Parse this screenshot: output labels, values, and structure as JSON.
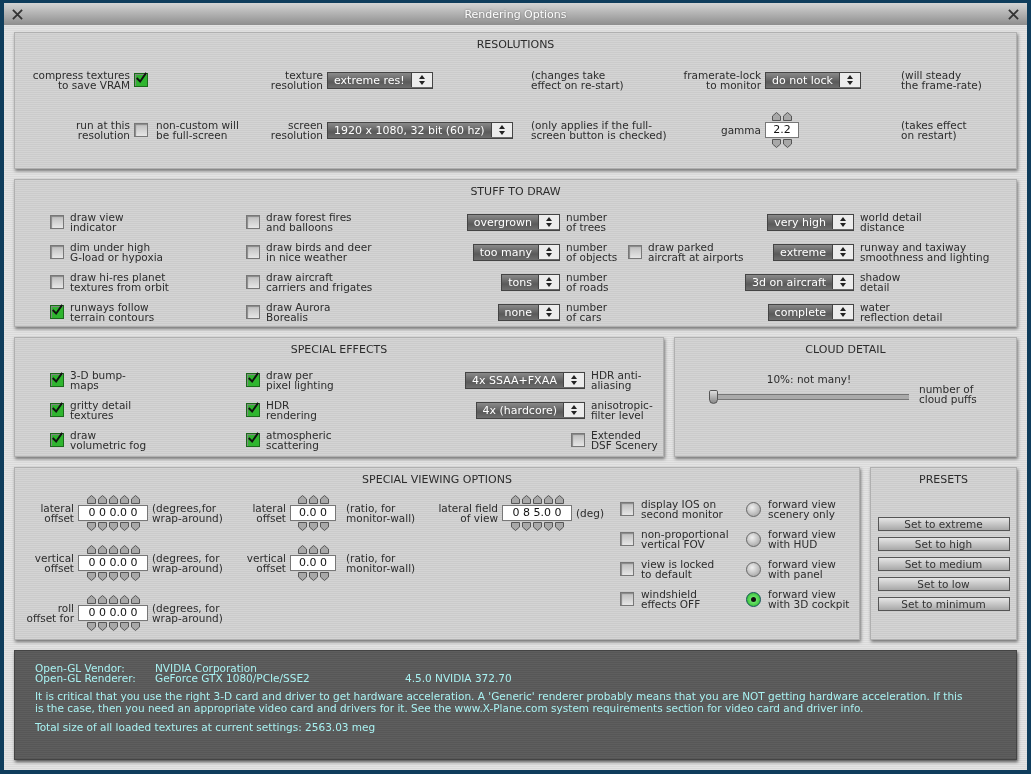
{
  "window": {
    "title": "Rendering Options"
  },
  "resolutions": {
    "title": "RESOLUTIONS",
    "rows": [
      [
        {
          "kind": "checkbox",
          "label": "compress textures\nto save VRAM",
          "checked": true
        },
        {
          "kind": "dropdown",
          "label": "texture\nresolution",
          "value": "extreme res!",
          "note": "(changes take\neffect on re-start)"
        },
        {
          "kind": "dropdown",
          "label": "framerate-lock\nto monitor",
          "value": "do not lock",
          "note": "(will steady\nthe frame-rate)"
        }
      ],
      [
        {
          "kind": "checkbox",
          "label": "run at this\nresolution",
          "note": "non-custom will\nbe full-screen",
          "checked": false
        },
        {
          "kind": "dropdown",
          "label": "screen\nresolution",
          "value": "1920 x 1080, 32 bit (60 hz)",
          "note": "(only applies if the full-\nscreen button is checked)"
        },
        {
          "kind": "spinner",
          "label": "gamma",
          "value": "2.2",
          "note": "(takes effect\non restart)"
        }
      ]
    ]
  },
  "stuff_to_draw": {
    "title": "STUFF TO DRAW",
    "rows": [
      [
        {
          "kind": "checkbox",
          "note": "draw view\nindicator",
          "checked": false
        },
        {
          "kind": "checkbox",
          "note": "draw forest fires\nand balloons",
          "checked": false
        },
        {
          "kind": "dropdown",
          "value": "overgrown",
          "note": "number\nof trees"
        },
        {
          "kind": "dropdown",
          "value": "very high",
          "note": "world detail\ndistance"
        }
      ],
      [
        {
          "kind": "checkbox",
          "note": "dim under high\nG-load or hypoxia",
          "checked": false
        },
        {
          "kind": "checkbox",
          "note": "draw birds and deer\nin nice weather",
          "checked": false
        },
        {
          "kind": "dropdown",
          "value": "too many",
          "note": "number\nof objects"
        },
        {
          "kind": "checkbox",
          "note": "draw parked\naircraft at airports",
          "checked": false
        },
        {
          "kind": "dropdown",
          "value": "extreme",
          "note": "runway and taxiway\nsmoothness and lighting"
        }
      ],
      [
        {
          "kind": "checkbox",
          "note": "draw hi-res planet\ntextures from orbit",
          "checked": false
        },
        {
          "kind": "checkbox",
          "note": "draw aircraft\ncarriers and frigates",
          "checked": false
        },
        {
          "kind": "dropdown",
          "value": "tons",
          "note": "number\nof roads"
        },
        {
          "kind": "dropdown",
          "value": "3d on aircraft",
          "note": "shadow\ndetail"
        }
      ],
      [
        {
          "kind": "checkbox",
          "note": "runways follow\nterrain contours",
          "checked": true
        },
        {
          "kind": "checkbox",
          "note": "draw Aurora\nBorealis",
          "checked": false
        },
        {
          "kind": "dropdown",
          "value": "none",
          "note": "number\nof cars"
        },
        {
          "kind": "dropdown",
          "value": "complete",
          "note": "water\nreflection detail"
        }
      ]
    ]
  },
  "special_effects": {
    "title": "SPECIAL EFFECTS",
    "rows": [
      [
        {
          "kind": "checkbox",
          "note": "3-D bump-\nmaps",
          "checked": true
        },
        {
          "kind": "checkbox",
          "note": "draw per\npixel lighting",
          "checked": true
        },
        {
          "kind": "dropdown",
          "value": "4x SSAA+FXAA",
          "note": "HDR anti-\naliasing"
        }
      ],
      [
        {
          "kind": "checkbox",
          "note": "gritty detail\ntextures",
          "checked": true
        },
        {
          "kind": "checkbox",
          "note": "HDR\nrendering",
          "checked": true
        },
        {
          "kind": "dropdown",
          "value": "4x (hardcore)",
          "note": "anisotropic-\nfilter level"
        }
      ],
      [
        {
          "kind": "checkbox",
          "note": "draw\nvolumetric fog",
          "checked": true
        },
        {
          "kind": "checkbox",
          "note": "atmospheric\nscattering",
          "checked": true
        },
        {
          "kind": "checkbox",
          "note": "Extended\nDSF Scenery",
          "checked": false
        }
      ]
    ]
  },
  "cloud_detail": {
    "title": "CLOUD DETAIL",
    "reading": "10%: not many!",
    "level": 0,
    "note": "number of\ncloud puffs"
  },
  "special_viewing_options": {
    "title": "SPECIAL VIEWING OPTIONS",
    "rows": [
      [
        {
          "kind": "spinner",
          "label": "lateral\noffset",
          "value": "0 0 0.0 0",
          "note": "(degrees,for\nwrap-around)"
        },
        {
          "kind": "spinner",
          "label": "lateral\noffset",
          "value": "0.0 0",
          "note": "(ratio, for\nmonitor-wall)"
        },
        {
          "kind": "spinner",
          "label": "lateral field\nof view",
          "value": "0 8 5.0 0",
          "note": "(deg)"
        }
      ],
      [
        {
          "kind": "spinner",
          "label": "vertical\noffset",
          "value": "0 0 0.0 0",
          "note": "(degrees, for\nwrap-around)"
        },
        {
          "kind": "spinner",
          "label": "vertical\noffset",
          "value": "0.0 0",
          "note": "(ratio, for\nmonitor-wall)"
        }
      ],
      [
        {
          "kind": "spinner",
          "label": "roll\noffset for",
          "value": "0 0 0.0 0",
          "note": "(degrees, for\nwrap-around)"
        }
      ]
    ],
    "toggles": [
      {
        "label": "display IOS on\nsecond monitor",
        "checked": false
      },
      {
        "label": "non-proportional\nvertical FOV",
        "checked": false
      },
      {
        "label": "view is locked\nto default",
        "checked": false
      },
      {
        "label": "windshield\neffects OFF",
        "checked": false
      }
    ],
    "views": [
      {
        "label": "forward view\nscenery only",
        "selected": false
      },
      {
        "label": "forward view\nwith HUD",
        "selected": false
      },
      {
        "label": "forward view\nwith panel",
        "selected": false
      },
      {
        "label": "forward view\nwith 3D cockpit",
        "selected": true
      }
    ]
  },
  "presets": {
    "title": "PRESETS",
    "buttons": [
      "Set to extreme",
      "Set to high",
      "Set to medium",
      "Set to low",
      "Set to minimum"
    ]
  },
  "info": {
    "vendor_label": "Open-GL Vendor:",
    "vendor": "NVIDIA Corporation",
    "renderer_label": "Open-GL Renderer:",
    "renderer": "GeForce GTX 1080/PCIe/SSE2",
    "version": "4.5.0 NVIDIA 372.70",
    "message": "It is critical that you use the right 3-D card and driver to get hardware acceleration. A 'Generic' renderer probably means that you are NOT getting hardware acceleration. If this is the case, then you need an appropriate video card and drivers for it. See the www.X-Plane.com system requirements section for video card and driver info.",
    "texture_total": "Total size of all loaded textures at current settings: 2563.03 meg"
  }
}
